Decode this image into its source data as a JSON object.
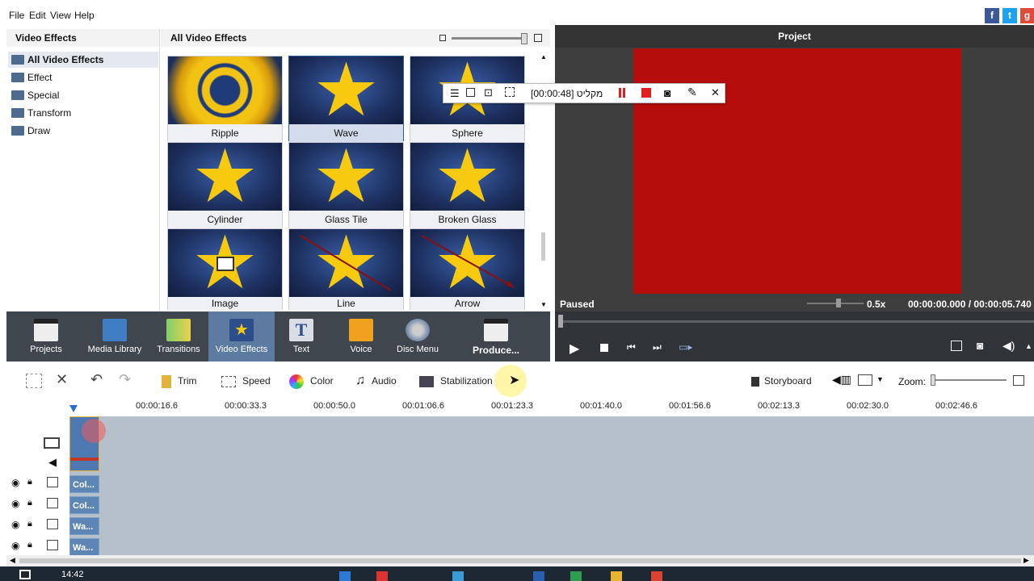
{
  "menu": [
    "File",
    "Edit",
    "View",
    "Help"
  ],
  "social": [
    "f",
    "t",
    "g"
  ],
  "left_panel": {
    "title": "Video Effects",
    "categories": [
      "All Video Effects",
      "Effect",
      "Special",
      "Transform",
      "Draw"
    ]
  },
  "grid_panel": {
    "title": "All Video Effects",
    "effects": [
      "Ripple",
      "Wave",
      "Sphere",
      "Cylinder",
      "Glass Tile",
      "Broken Glass",
      "Image",
      "Line",
      "Arrow"
    ]
  },
  "preview": {
    "title": "Project",
    "status": "Paused",
    "speed": "0.5x",
    "time": "00:00:00.000 / 00:00:05.740"
  },
  "recorder": {
    "label": "מקליט [00:00:48]"
  },
  "toolbar": {
    "items": [
      "Projects",
      "Media Library",
      "Transitions",
      "Video Effects",
      "Text",
      "Voice",
      "Disc Menu",
      "Produce..."
    ]
  },
  "editbar": {
    "trim": "Trim",
    "speed": "Speed",
    "color": "Color",
    "audio": "Audio",
    "stabilization": "Stabilization",
    "storyboard": "Storyboard",
    "zoom": "Zoom:"
  },
  "ruler": [
    "00:00:16.6",
    "00:00:33.3",
    "00:00:50.0",
    "00:01:06.6",
    "00:01:23.3",
    "00:01:40.0",
    "00:01:56.6",
    "00:02:13.3",
    "00:02:30.0",
    "00:02:46.6"
  ],
  "tracks": [
    "Col...",
    "Col...",
    "Wa...",
    "Wa..."
  ],
  "taskbar": {
    "clock": "14:42"
  }
}
